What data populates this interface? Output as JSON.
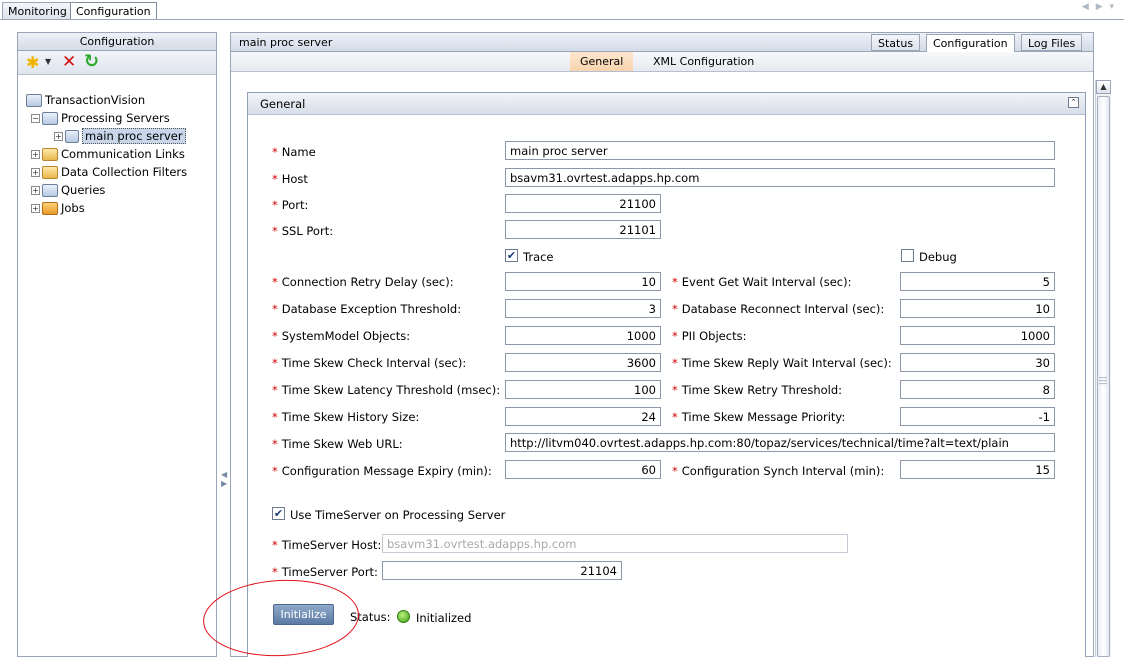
{
  "top_tabs": [
    {
      "label": "Monitoring"
    },
    {
      "label": "Configuration"
    }
  ],
  "left_panel": {
    "title": "Configuration",
    "toolbar": {
      "new_icon": "star-new-icon",
      "dropdown_icon": "dropdown-arrow-icon",
      "delete_icon": "red-x-delete-icon",
      "refresh_icon": "green-refresh-icon"
    },
    "tree": {
      "root": "TransactionVision",
      "items": [
        {
          "label": "Processing Servers"
        },
        {
          "label": "main proc server"
        },
        {
          "label": "Communication Links"
        },
        {
          "label": "Data Collection Filters"
        },
        {
          "label": "Queries"
        },
        {
          "label": "Jobs"
        }
      ]
    }
  },
  "right_panel": {
    "title": "main proc server",
    "tabs": [
      {
        "label": "Status"
      },
      {
        "label": "Configuration"
      },
      {
        "label": "Log Files"
      }
    ],
    "subtabs": [
      {
        "label": "General"
      },
      {
        "label": "XML Configuration"
      }
    ],
    "group_title": "General",
    "form": {
      "name_label": "Name",
      "name_value": "main proc server",
      "host_label": "Host",
      "host_value": "bsavm31.ovrtest.adapps.hp.com",
      "port_label": "Port:",
      "port_value": "21100",
      "ssl_port_label": "SSL Port:",
      "ssl_port_value": "21101",
      "trace_label": "Trace",
      "trace_checked": "✔",
      "debug_label": "Debug",
      "left_fields": [
        {
          "label": "Connection Retry Delay (sec):",
          "value": "10"
        },
        {
          "label": "Database Exception Threshold:",
          "value": "3"
        },
        {
          "label": "SystemModel Objects:",
          "value": "1000"
        },
        {
          "label": "Time Skew Check Interval (sec):",
          "value": "3600"
        },
        {
          "label": "Time Skew Latency Threshold (msec):",
          "value": "100"
        },
        {
          "label": "Time Skew History Size:",
          "value": "24"
        }
      ],
      "right_fields": [
        {
          "label": "Event Get Wait Interval (sec):",
          "value": "5"
        },
        {
          "label": "Database Reconnect Interval (sec):",
          "value": "10"
        },
        {
          "label": "PII Objects:",
          "value": "1000"
        },
        {
          "label": "Time Skew Reply Wait Interval (sec):",
          "value": "30"
        },
        {
          "label": "Time Skew Retry Threshold:",
          "value": "8"
        },
        {
          "label": "Time Skew Message Priority:",
          "value": "-1"
        }
      ],
      "web_url_label": "Time Skew Web URL:",
      "web_url_value": "http://litvm040.ovrtest.adapps.hp.com:80/topaz/services/technical/time?alt=text/plain",
      "config_expiry_label": "Configuration Message Expiry (min):",
      "config_expiry_value": "60",
      "config_synch_label": "Configuration Synch Interval (min):",
      "config_synch_value": "15",
      "use_timeserver_label": "Use TimeServer on Processing Server",
      "use_timeserver_checked": "✔",
      "timeserver_host_label": "TimeServer Host:",
      "timeserver_host_value": "bsavm31.ovrtest.adapps.hp.com",
      "timeserver_port_label": "TimeServer Port:",
      "timeserver_port_value": "21104",
      "initialize_label": "Initialize",
      "status_label": "Status:",
      "status_value": "Initialized"
    }
  },
  "colors": {
    "required_asterisk": "#d40000",
    "annotation_ellipse": "#e0101a",
    "status_ok": "#3f9f14",
    "button_blue": "#5b7aa3"
  }
}
